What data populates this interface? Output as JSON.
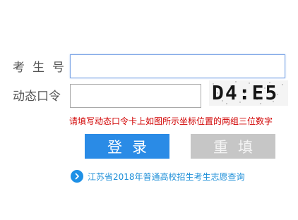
{
  "form": {
    "exam_number_label": "考生号",
    "exam_number_value": "",
    "dynamic_password_label": "动态口令",
    "dynamic_password_value": "",
    "captcha_text": "D4:E5",
    "hint": "请填写动态口令卡上如图所示坐标位置的两组三位数字"
  },
  "buttons": {
    "login_label": "登录",
    "reset_label": "重填",
    "login_color": "#2a8be6",
    "reset_color": "#c6c6c6"
  },
  "link": {
    "icon": "chevron-right-circle-icon",
    "text": "江苏省2018年普通高校招生考生志愿查询"
  }
}
